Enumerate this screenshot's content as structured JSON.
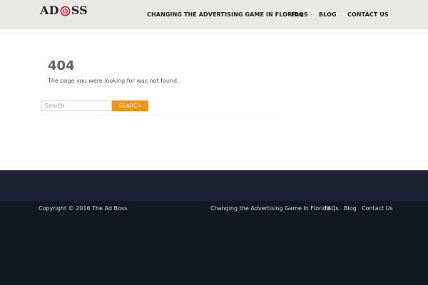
{
  "header": {
    "logo": {
      "text_before": "AD",
      "text_after": "SS",
      "icon": "target-icon"
    },
    "nav": [
      {
        "label": "CHANGING THE ADVERTISING GAME IN FLORIDA"
      },
      {
        "label": "FAQS"
      },
      {
        "label": "BLOG"
      },
      {
        "label": "CONTACT US"
      }
    ]
  },
  "main": {
    "error_code": "404",
    "message": "The page you were looking for was not found.",
    "search": {
      "placeholder": "Search",
      "value": "",
      "button_label": "SEARCH"
    }
  },
  "footer": {
    "copyright": "Copyright © 2016 The Ad Boss",
    "links": [
      {
        "label": "Changing the Advertising Game In Florida"
      },
      {
        "label": "FAQs"
      },
      {
        "label": "Blog"
      },
      {
        "label": "Contact Us"
      }
    ]
  },
  "colors": {
    "header_bg": "#e8e8e6",
    "accent": "#f39312",
    "footer_top": "#1c2234",
    "footer_bottom": "#131722",
    "logo_red": "#d7232d"
  }
}
